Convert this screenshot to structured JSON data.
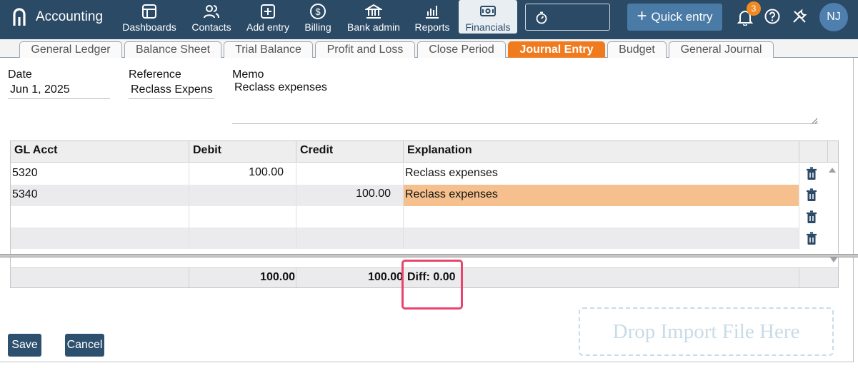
{
  "app": {
    "title": "Accounting"
  },
  "nav": [
    {
      "label": "Dashboards",
      "icon": "dashboard-icon"
    },
    {
      "label": "Contacts",
      "icon": "contacts-icon"
    },
    {
      "label": "Add entry",
      "icon": "add-entry-icon"
    },
    {
      "label": "Billing",
      "icon": "billing-icon"
    },
    {
      "label": "Bank admin",
      "icon": "bank-icon"
    },
    {
      "label": "Reports",
      "icon": "reports-icon"
    },
    {
      "label": "Financials",
      "icon": "financials-icon",
      "active": true
    }
  ],
  "header": {
    "quick_entry_label": "Quick entry",
    "notification_count": "3",
    "avatar_initials": "NJ"
  },
  "tabs": [
    {
      "label": "General Ledger"
    },
    {
      "label": "Balance Sheet"
    },
    {
      "label": "Trial Balance"
    },
    {
      "label": "Profit and Loss"
    },
    {
      "label": "Close Period"
    },
    {
      "label": "Journal Entry",
      "active": true
    },
    {
      "label": "Budget"
    },
    {
      "label": "General Journal"
    }
  ],
  "form": {
    "date_label": "Date",
    "date_value": "Jun 1, 2025",
    "reference_label": "Reference",
    "reference_value": "Reclass Expens",
    "memo_label": "Memo",
    "memo_value": "Reclass expenses"
  },
  "grid": {
    "columns": [
      "GL Acct",
      "Debit",
      "Credit",
      "Explanation"
    ],
    "rows": [
      {
        "acct": "5320",
        "debit": "100.00",
        "credit": "",
        "explanation": "Reclass expenses"
      },
      {
        "acct": "5340",
        "debit": "",
        "credit": "100.00",
        "explanation": "Reclass expenses"
      },
      {
        "acct": "",
        "debit": "",
        "credit": "",
        "explanation": ""
      },
      {
        "acct": "",
        "debit": "",
        "credit": "",
        "explanation": ""
      }
    ],
    "totals": {
      "debit": "100.00",
      "credit": "100.00",
      "diff": "Diff: 0.00"
    }
  },
  "buttons": {
    "save": "Save",
    "cancel": "Cancel"
  },
  "drop_zone": {
    "label": "Drop Import File Here"
  },
  "colors": {
    "topbar": "#2b4a66",
    "active_tab": "#f07b1e",
    "highlight": "#f5c08d",
    "callout": "#e8446d"
  }
}
